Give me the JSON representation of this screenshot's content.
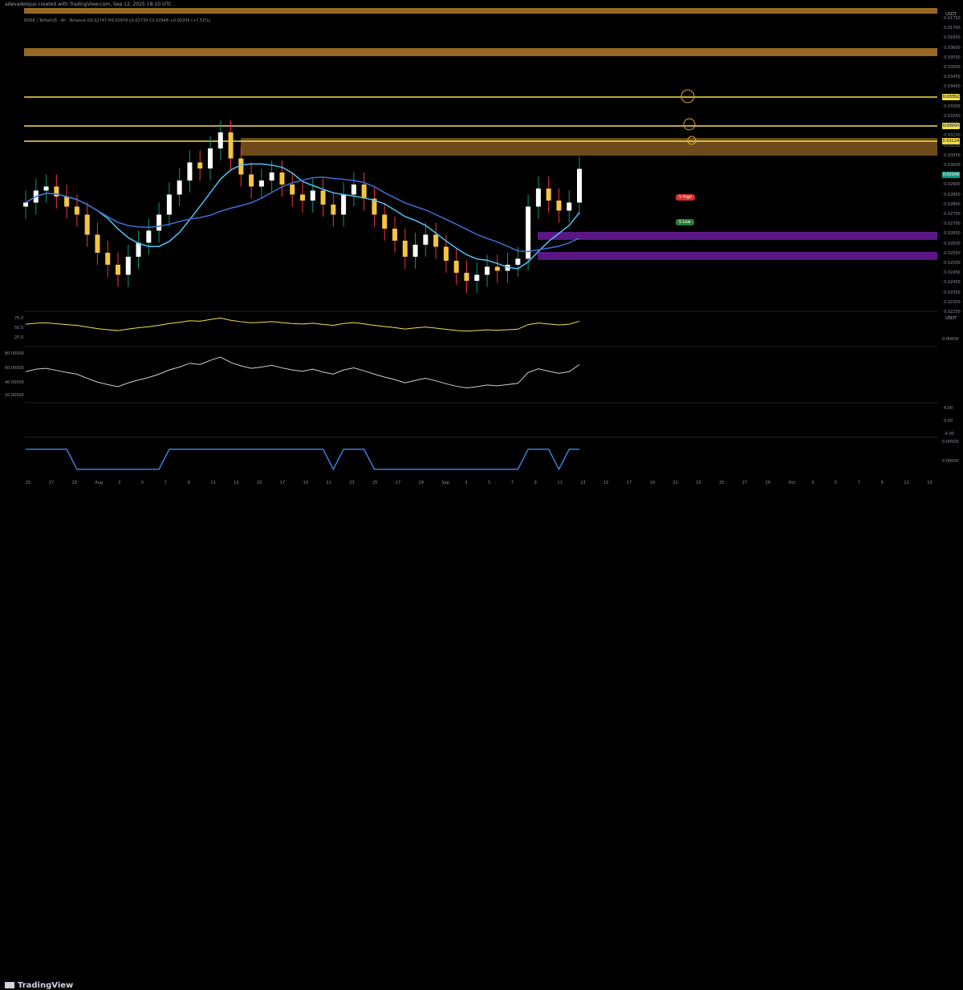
{
  "header": {
    "title": "adevadeIsjus created with TradingView.com, Sep 12, 2025 18:10 UTC"
  },
  "symbol": {
    "line": "ROSE / TetherUS · 4h · Binance  O0.02747 H0.02978 L0.02739 C0.02948 +0.00206 (+7.51%)"
  },
  "axis": {
    "currency_label": "USDT",
    "price_ticks": [
      "0.01750",
      "0.01700",
      "0.01650",
      "0.03600",
      "0.03550",
      "0.03500",
      "0.03450",
      "0.03400",
      "0.03350",
      "0.03300",
      "0.03250",
      "0.03200",
      "0.03150",
      "0.03100",
      "0.03050",
      "0.03000",
      "0.02950",
      "0.02900",
      "0.02850",
      "0.02800",
      "0.02750",
      "0.02700",
      "0.02650",
      "0.02600",
      "0.02550",
      "0.02500",
      "0.02450",
      "0.02400",
      "0.02350",
      "0.02300",
      "0.02250"
    ],
    "level_tags": [
      "0.03352",
      "0.03204",
      "0.03124"
    ],
    "last_price": "0.02948",
    "rsi_ticks": [
      "75.0",
      "50.0",
      "25.0"
    ],
    "rsi_right": "USDT",
    "rsi_zero": "0.00000",
    "stoch_ticks": [
      "80.00000",
      "60.00000",
      "40.00000",
      "20.00000"
    ],
    "osc_ticks": [
      "4.00",
      "0.00",
      "-4.00"
    ],
    "bottom_ticks": [
      "0.00500",
      "0.00000"
    ]
  },
  "labels": {
    "s_high": "S High",
    "s_low": "S Low"
  },
  "time_axis": [
    "25",
    "27",
    "29",
    "Aug",
    "3",
    "5",
    "7",
    "9",
    "11",
    "13",
    "15",
    "17",
    "19",
    "21",
    "23",
    "25",
    "27",
    "29",
    "Sep",
    "3",
    "5",
    "7",
    "9",
    "11",
    "13",
    "15",
    "17",
    "19",
    "21",
    "23",
    "25",
    "27",
    "29",
    "Oct",
    "3",
    "5",
    "7",
    "9",
    "11",
    "13"
  ],
  "brand": {
    "name": "TradingView"
  },
  "colors": {
    "up": "#089981",
    "down": "#f23645",
    "zone_gold": "#c8923a",
    "zone_purple": "#6a1b9a",
    "yellow_line": "#f5e04a"
  },
  "chart_data": {
    "type": "candlestick",
    "title": "ROSE / TetherUS · 4h · Binance",
    "ylim": [
      0.0225,
      0.0375
    ],
    "resistance_levels": [
      0.03352,
      0.03204,
      0.03124
    ],
    "close_series": [
      0.0278,
      0.0284,
      0.0286,
      0.0281,
      0.0276,
      0.0272,
      0.0262,
      0.0253,
      0.0247,
      0.0242,
      0.0251,
      0.0258,
      0.0264,
      0.0272,
      0.0282,
      0.0289,
      0.0298,
      0.0295,
      0.0305,
      0.0313,
      0.03,
      0.0292,
      0.0286,
      0.0289,
      0.0293,
      0.0287,
      0.0282,
      0.0279,
      0.0284,
      0.0277,
      0.0272,
      0.0282,
      0.0287,
      0.028,
      0.0272,
      0.0265,
      0.0259,
      0.0251,
      0.0257,
      0.0262,
      0.0256,
      0.0249,
      0.0243,
      0.0239,
      0.0242,
      0.0246,
      0.0244,
      0.0247,
      0.025,
      0.0276,
      0.0285,
      0.0279,
      0.0274,
      0.0278,
      0.02948
    ]
  }
}
